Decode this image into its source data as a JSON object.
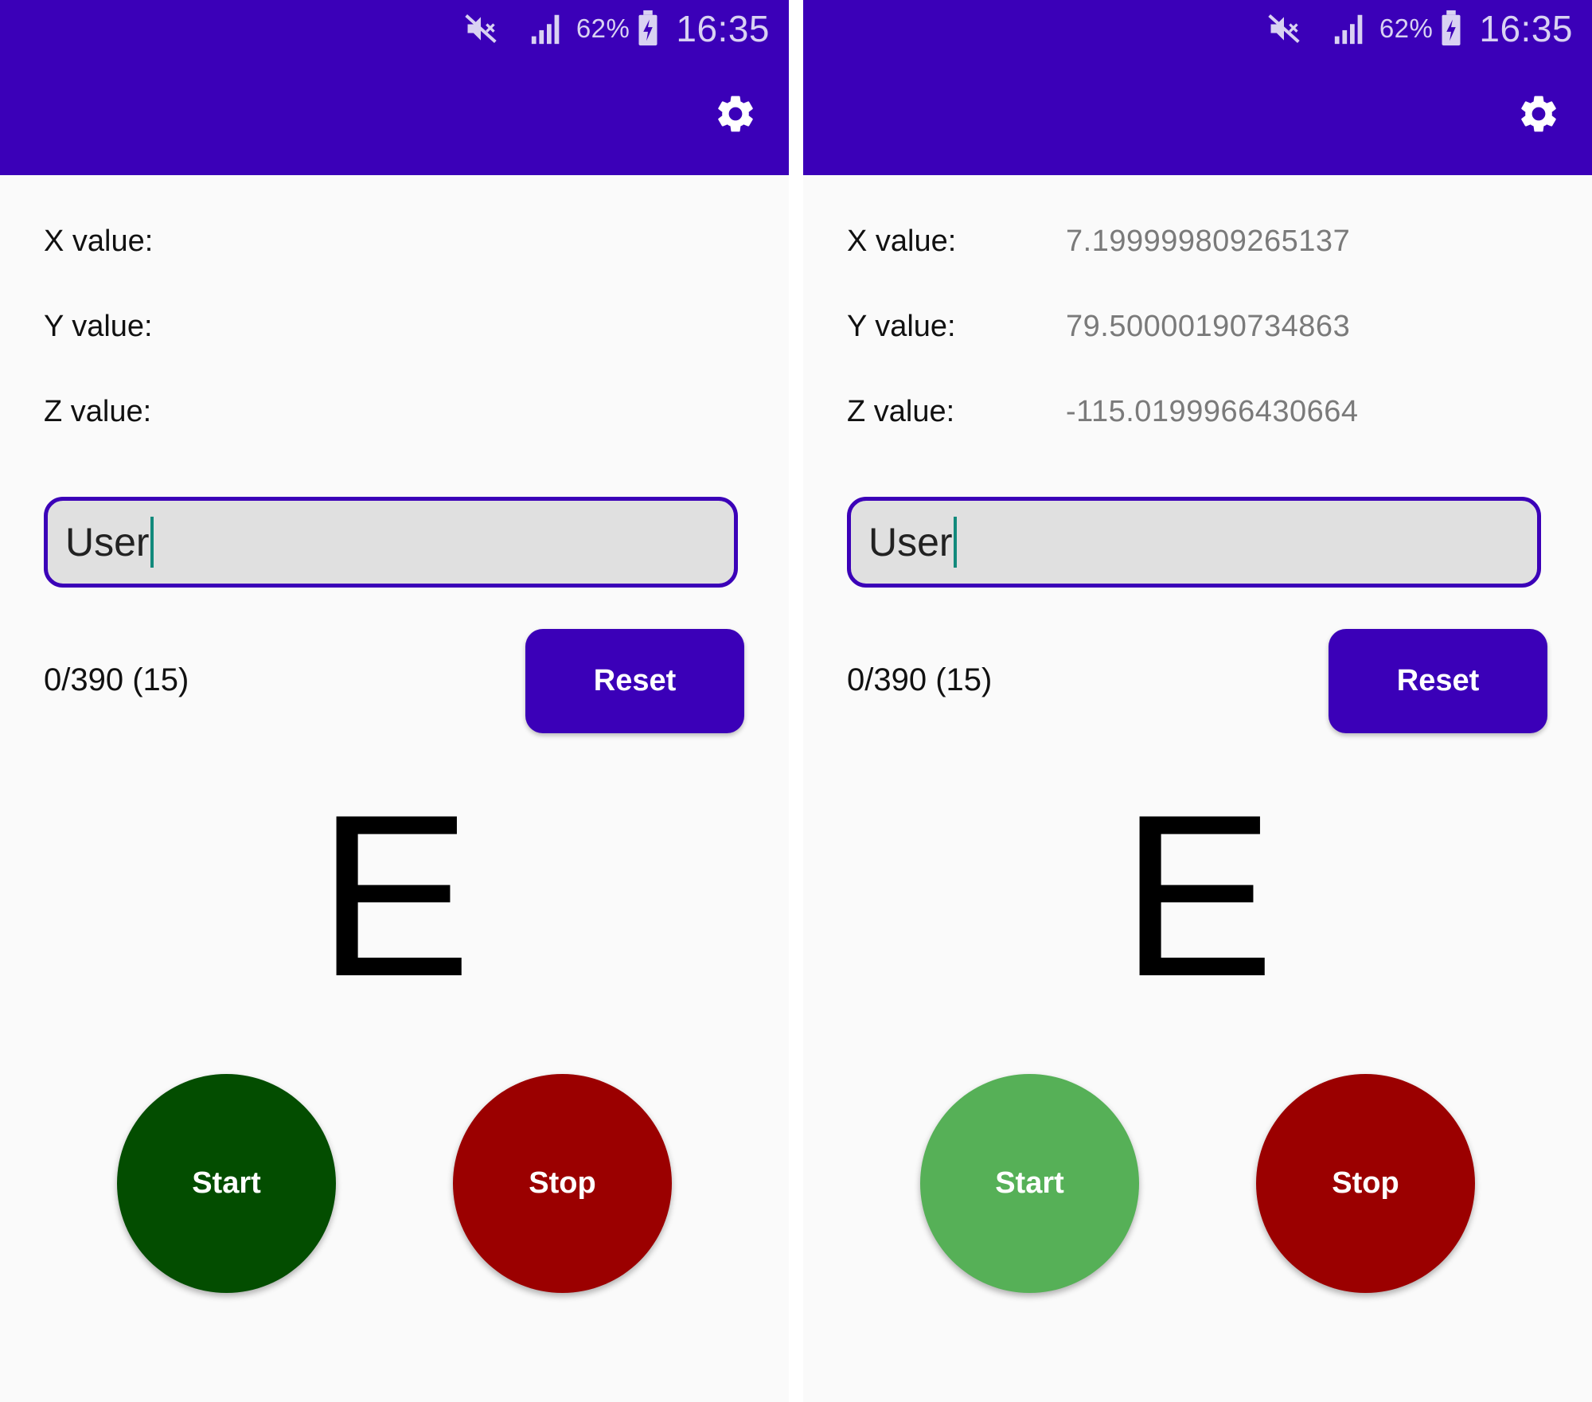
{
  "colors": {
    "primary": "#3b00b8",
    "caret": "#128a7c",
    "start_dark": "#034d00",
    "start_light": "#56b057",
    "stop": "#9b0000"
  },
  "screens": [
    {
      "status_bar": {
        "mute_icon": "mute-icon",
        "signal_icon": "signal-icon",
        "battery_percent": "62%",
        "battery_icon": "battery-charging-icon",
        "time": "16:35"
      },
      "toolbar": {
        "settings_icon": "gear-icon"
      },
      "sensors": [
        {
          "label": "X value:",
          "value": ""
        },
        {
          "label": "Y value:",
          "value": ""
        },
        {
          "label": "Z value:",
          "value": ""
        }
      ],
      "user_input": {
        "value": "User"
      },
      "counter": "0/390 (15)",
      "reset_label": "Reset",
      "letter": "E",
      "start": {
        "label": "Start",
        "color": "#034d00"
      },
      "stop": {
        "label": "Stop",
        "color": "#9b0000"
      }
    },
    {
      "status_bar": {
        "mute_icon": "mute-icon",
        "signal_icon": "signal-icon",
        "battery_percent": "62%",
        "battery_icon": "battery-charging-icon",
        "time": "16:35"
      },
      "toolbar": {
        "settings_icon": "gear-icon"
      },
      "sensors": [
        {
          "label": "X value:",
          "value": "7.199999809265137"
        },
        {
          "label": "Y value:",
          "value": "79.50000190734863"
        },
        {
          "label": "Z value:",
          "value": "-115.0199966430664"
        }
      ],
      "user_input": {
        "value": "User"
      },
      "counter": "0/390 (15)",
      "reset_label": "Reset",
      "letter": "E",
      "start": {
        "label": "Start",
        "color": "#56b057"
      },
      "stop": {
        "label": "Stop",
        "color": "#9b0000"
      }
    }
  ]
}
